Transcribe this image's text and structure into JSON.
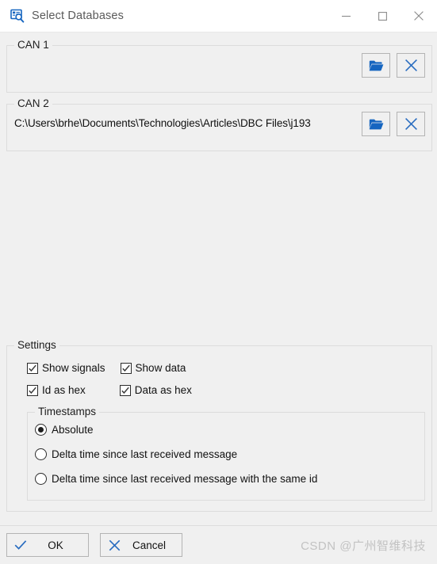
{
  "window": {
    "title": "Select Databases",
    "icon": "database-search-icon",
    "controls": {
      "minimize": "minimize-icon",
      "maximize": "maximize-icon",
      "close": "close-icon"
    }
  },
  "databases": [
    {
      "group_label": "CAN 1",
      "path": "",
      "browse_icon": "folder-open-icon",
      "clear_icon": "close-x-icon"
    },
    {
      "group_label": "CAN 2",
      "path": "C:\\Users\\brhe\\Documents\\Technologies\\Articles\\DBC Files\\j193",
      "browse_icon": "folder-open-icon",
      "clear_icon": "close-x-icon"
    }
  ],
  "settings": {
    "group_label": "Settings",
    "checkboxes": [
      {
        "label": "Show signals",
        "checked": true
      },
      {
        "label": "Show data",
        "checked": true
      },
      {
        "label": "Id as hex",
        "checked": true
      },
      {
        "label": "Data as hex",
        "checked": true
      }
    ],
    "timestamps": {
      "group_label": "Timestamps",
      "options": [
        {
          "label": "Absolute",
          "selected": true
        },
        {
          "label": "Delta time since last received message",
          "selected": false
        },
        {
          "label": "Delta time since last received message with the same id",
          "selected": false
        }
      ]
    }
  },
  "footer": {
    "ok_label": "OK",
    "ok_icon": "check-icon",
    "cancel_label": "Cancel",
    "cancel_icon": "x-icon"
  },
  "watermark": "CSDN @广州智维科技",
  "colors": {
    "accent_blue": "#1565c0",
    "window_bg": "#f0f0f0",
    "titlebar_bg": "#ffffff",
    "border": "#dcdcdc"
  }
}
